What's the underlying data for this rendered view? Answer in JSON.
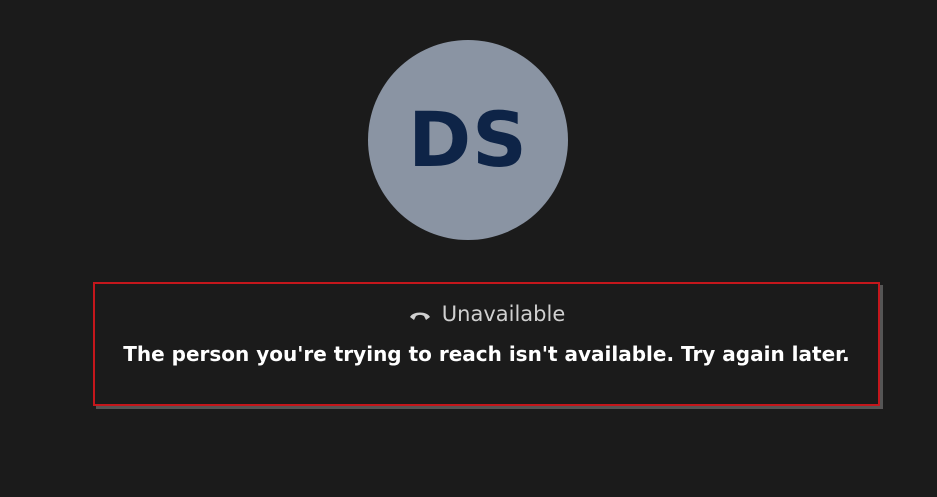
{
  "call": {
    "avatar": {
      "initials": "DS",
      "bg_color": "#8a94a3",
      "text_color": "#0e2447"
    },
    "status": {
      "icon": "hang-up-phone-icon",
      "label": "Unavailable",
      "message": "The person you're trying to reach isn't available. Try again later.",
      "highlight_color": "#c4171c"
    }
  }
}
